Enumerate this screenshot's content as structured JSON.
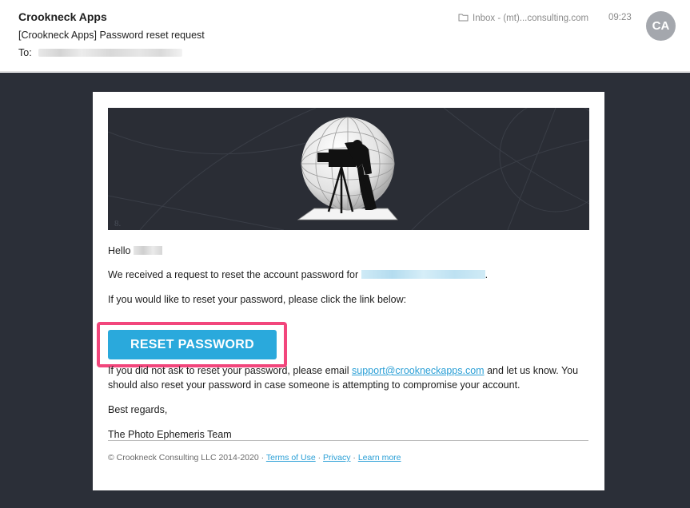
{
  "header": {
    "sender": "Crookneck Apps",
    "subject": "[Crookneck Apps] Password reset request",
    "to_label": "To:",
    "folder": "Inbox - (mt)...consulting.com",
    "time": "09:23",
    "avatar_initials": "CA"
  },
  "email": {
    "greeting": "Hello",
    "request_text": "We received a request to reset the account password for",
    "request_end": ".",
    "instruction": "If you would like to reset your password, please click the link below:",
    "button_label": "RESET PASSWORD",
    "notice_part1": "If you did not ask to reset your password, please email",
    "support_email": "support@crookneckapps.com",
    "notice_part2": "and let us know. You",
    "notice_line2": "should also reset your password in case someone is attempting to compromise your account.",
    "regards": "Best regards,",
    "team": "The Photo Ephemeris Team",
    "banner_mark": "8."
  },
  "footer": {
    "copyright": "© Crookneck Consulting LLC 2014-2020 ·",
    "terms": "Terms of Use",
    "sep1": "·",
    "privacy": "Privacy",
    "sep2": "·",
    "learn_more": "Learn more"
  },
  "colors": {
    "button": "#2aa9dc",
    "highlight": "#f2467c",
    "link": "#2a9fd6",
    "body_bg": "#2b2f38"
  }
}
